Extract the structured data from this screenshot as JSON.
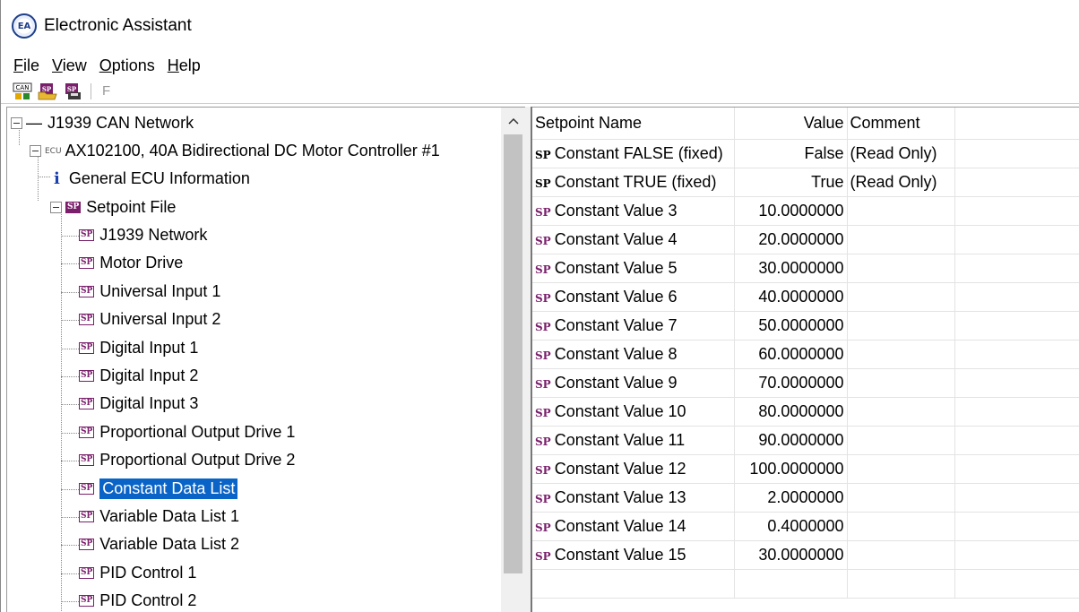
{
  "window": {
    "title": "Electronic Assistant"
  },
  "menu": [
    {
      "label": "File",
      "key": "F",
      "rest": "ile"
    },
    {
      "label": "View",
      "key": "V",
      "rest": "iew"
    },
    {
      "label": "Options",
      "key": "O",
      "rest": "ptions"
    },
    {
      "label": "Help",
      "key": "H",
      "rest": "elp"
    }
  ],
  "toolbar": {
    "f_label": "F"
  },
  "tree": {
    "network": "J1939 CAN Network",
    "ecu_tag": "ECU",
    "ecu": "AX102100, 40A Bidirectional DC Motor Controller #1",
    "info_icon": "i",
    "general_info": "General ECU Information",
    "setpoint_file": "Setpoint File",
    "badge": "SP",
    "items": [
      "J1939 Network",
      "Motor Drive",
      "Universal Input 1",
      "Universal Input 2",
      "Digital Input 1",
      "Digital Input 2",
      "Digital Input 3",
      "Proportional Output Drive 1",
      "Proportional Output Drive 2",
      "Constant Data List",
      "Variable Data List 1",
      "Variable Data List 2",
      "PID Control 1",
      "PID Control 2"
    ],
    "selected_index": 9
  },
  "grid": {
    "headers": {
      "name": "Setpoint Name",
      "value": "Value",
      "comment": "Comment"
    },
    "sp_mark": "SP",
    "rows": [
      {
        "name": "Constant FALSE (fixed)",
        "value": "False",
        "comment": "(Read Only)",
        "mark": "black"
      },
      {
        "name": "Constant TRUE (fixed)",
        "value": "True",
        "comment": "(Read Only)",
        "mark": "black"
      },
      {
        "name": "Constant Value 3",
        "value": "10.0000000",
        "comment": "",
        "mark": "purple"
      },
      {
        "name": "Constant Value 4",
        "value": "20.0000000",
        "comment": "",
        "mark": "purple"
      },
      {
        "name": "Constant Value 5",
        "value": "30.0000000",
        "comment": "",
        "mark": "purple"
      },
      {
        "name": "Constant Value 6",
        "value": "40.0000000",
        "comment": "",
        "mark": "purple"
      },
      {
        "name": "Constant Value 7",
        "value": "50.0000000",
        "comment": "",
        "mark": "purple"
      },
      {
        "name": "Constant Value 8",
        "value": "60.0000000",
        "comment": "",
        "mark": "purple"
      },
      {
        "name": "Constant Value 9",
        "value": "70.0000000",
        "comment": "",
        "mark": "purple"
      },
      {
        "name": "Constant Value 10",
        "value": "80.0000000",
        "comment": "",
        "mark": "purple"
      },
      {
        "name": "Constant Value 11",
        "value": "90.0000000",
        "comment": "",
        "mark": "purple"
      },
      {
        "name": "Constant Value 12",
        "value": "100.0000000",
        "comment": "",
        "mark": "purple"
      },
      {
        "name": "Constant Value 13",
        "value": "2.0000000",
        "comment": "",
        "mark": "purple"
      },
      {
        "name": "Constant Value 14",
        "value": "0.4000000",
        "comment": "",
        "mark": "purple"
      },
      {
        "name": "Constant Value 15",
        "value": "30.0000000",
        "comment": "",
        "mark": "purple"
      }
    ]
  }
}
